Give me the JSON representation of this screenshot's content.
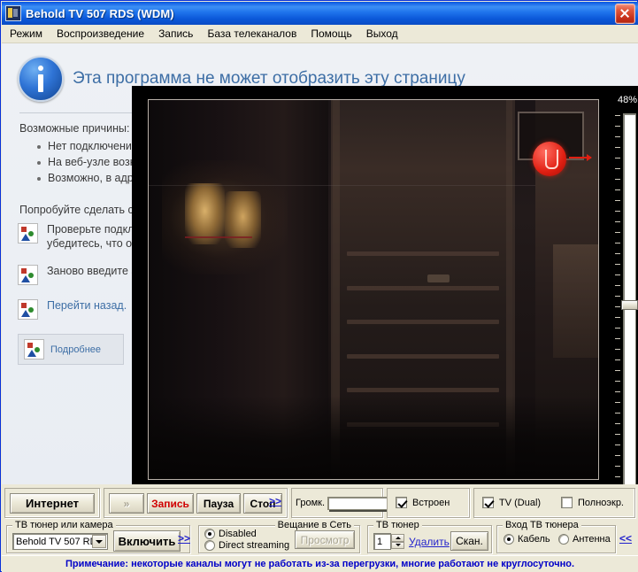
{
  "window": {
    "title": "Behold TV 507 RDS (WDM)",
    "close_label": "×",
    "icon": "tv-tuner-icon"
  },
  "menu": {
    "items": [
      {
        "label": "Режим"
      },
      {
        "label": "Воспроизведение"
      },
      {
        "label": "Запись"
      },
      {
        "label": "База телеканалов"
      },
      {
        "label": "Помощь"
      },
      {
        "label": "Выход"
      }
    ]
  },
  "error_page": {
    "heading": "Эта программа не может отобразить эту страницу",
    "causes_intro": "Возможные причины:",
    "causes": [
      "Нет подключения к Интернету.",
      "На веб-узле возникли неполадки.",
      "Возможно, в адресе ошибка."
    ],
    "try_intro": "Попробуйте сделать следующее:",
    "actions": [
      {
        "line1": "Проверьте подключение к Интернету и",
        "line2": "убедитесь, что оно работает.",
        "link": false
      },
      {
        "line1": "Заново введите адрес.",
        "line2": "",
        "link": false
      },
      {
        "line1": "Перейти назад.",
        "line2": "",
        "link": true
      }
    ],
    "more_button": "Подробнее"
  },
  "video": {
    "slider_percent": "48%",
    "slider_value": 48,
    "marker_label": "U"
  },
  "toolbar": {
    "internet_button": "Интернет",
    "prev_button": "»",
    "record_button": "Запись",
    "pause_button": "Пауза",
    "stop_button": "Стоп",
    "expand_link": ">>",
    "volume_label": "Громк.",
    "volume_value": 100,
    "builtin_checkbox": {
      "label": "Встроен",
      "checked": true
    },
    "tv_dual_checkbox": {
      "label": "TV (Dual)",
      "checked": true
    },
    "fullscreen_checkbox": {
      "label": "Полноэкр.",
      "checked": false
    }
  },
  "tuner_group": {
    "title": "ТВ тюнер или камера",
    "device_value": "Behold TV 507 RD",
    "enable_button": "Включить",
    "expand_link": ">>"
  },
  "broadcast_group": {
    "title": "Вещание в Сеть",
    "options": [
      {
        "label": "Disabled",
        "selected": true
      },
      {
        "label": "Direct streaming",
        "selected": false
      }
    ],
    "preview_button": "Просмотр"
  },
  "channel_group": {
    "title": "ТВ тюнер",
    "channel_value": "1",
    "delete_link": "Удалить",
    "scan_button": "Скан."
  },
  "input_group": {
    "title": "Вход ТВ тюнера",
    "options": [
      {
        "label": "Кабель",
        "selected": true
      },
      {
        "label": "Антенна",
        "selected": false
      }
    ],
    "collapse_link": "<<"
  },
  "statusbar": {
    "note": "Примечание: некоторые каналы могут не работать из-за перегрузки, многие работают не круглосуточно."
  },
  "colors": {
    "title_blue": "#0a57d8",
    "record_red": "#d00000",
    "link_blue": "#2222cc",
    "status_blue": "#0000c8",
    "face": "#ece9d8"
  }
}
